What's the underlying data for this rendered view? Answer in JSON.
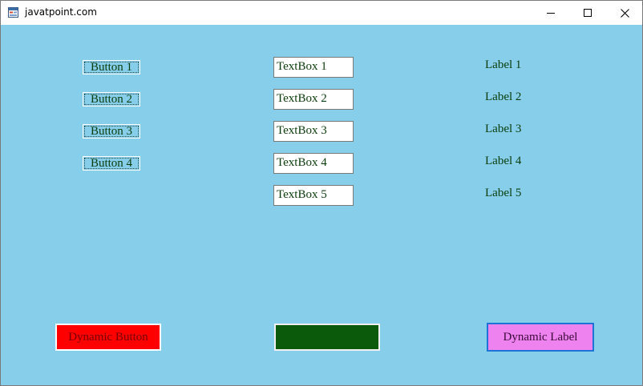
{
  "window": {
    "title": "javatpoint.com",
    "app_icon": "form-app-icon",
    "controls": {
      "minimize_icon": "minimize-icon",
      "maximize_icon": "maximize-icon",
      "close_icon": "close-icon"
    }
  },
  "form": {
    "background_color": "#87ceeb",
    "buttons": [
      {
        "label": "Button 1"
      },
      {
        "label": "Button 2"
      },
      {
        "label": "Button 3"
      },
      {
        "label": "Button 4"
      }
    ],
    "textboxes": [
      {
        "value": "TextBox 1"
      },
      {
        "value": "TextBox 2"
      },
      {
        "value": "TextBox 3"
      },
      {
        "value": "TextBox 4"
      },
      {
        "value": "TextBox 5"
      }
    ],
    "labels": [
      {
        "text": "Label 1"
      },
      {
        "text": "Label 2"
      },
      {
        "text": "Label 3"
      },
      {
        "text": "Label 4"
      },
      {
        "text": "Label 5"
      }
    ],
    "text_color": "#0b3d0b",
    "dynamic_button": {
      "label": "Dynamic Button",
      "background_color": "#ff0000",
      "text_color": "#7a0000"
    },
    "dynamic_textbox": {
      "value": "",
      "background_color": "#0b5a0b"
    },
    "dynamic_label": {
      "text": "Dynamic Label",
      "background_color": "#ee82ee",
      "text_color": "#3a0a3a"
    }
  }
}
